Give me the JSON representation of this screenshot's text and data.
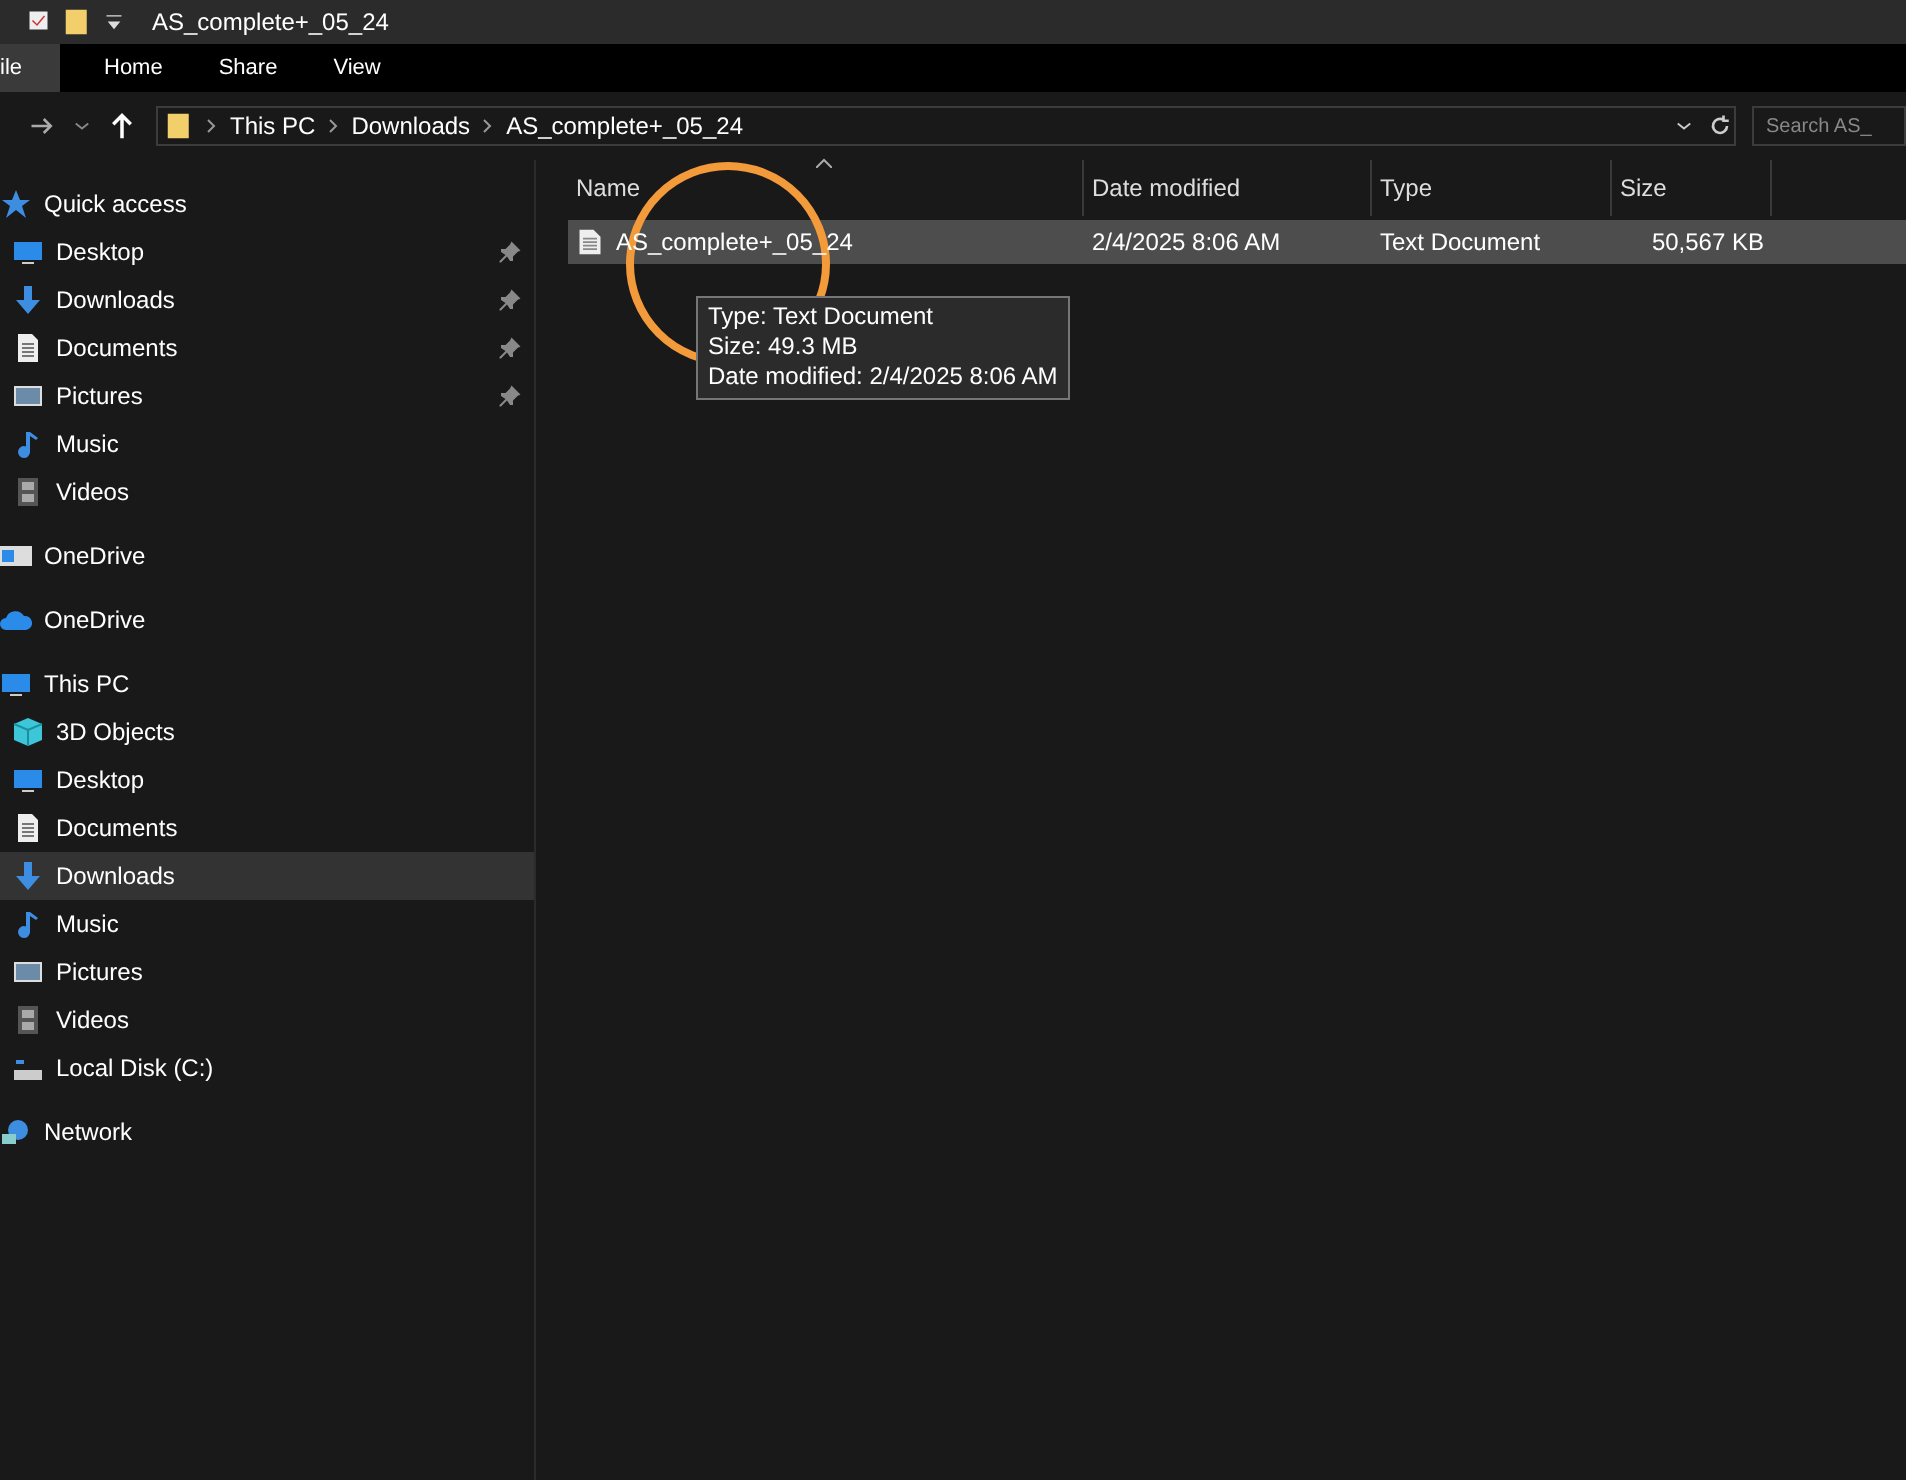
{
  "title_bar": {
    "title": "AS_complete+_05_24"
  },
  "ribbon_tabs": [
    {
      "label": "ile",
      "selected": true
    },
    {
      "label": "Home",
      "selected": false
    },
    {
      "label": "Share",
      "selected": false
    },
    {
      "label": "View",
      "selected": false
    }
  ],
  "address_bar": {
    "path": [
      "This PC",
      "Downloads",
      "AS_complete+_05_24"
    ]
  },
  "search": {
    "placeholder": "Search AS_"
  },
  "sidebar": {
    "items": [
      {
        "label": "Quick access",
        "selected": false,
        "children": [
          {
            "label": "Desktop",
            "pinned": true,
            "selected": false
          },
          {
            "label": "Downloads",
            "pinned": true,
            "selected": false
          },
          {
            "label": "Documents",
            "pinned": true,
            "selected": false
          },
          {
            "label": "Pictures",
            "pinned": true,
            "selected": false
          },
          {
            "label": "Music",
            "pinned": false,
            "selected": false
          },
          {
            "label": "Videos",
            "pinned": false,
            "selected": false
          }
        ]
      },
      {
        "label": "OneDrive",
        "selected": false
      },
      {
        "label": "OneDrive",
        "selected": false
      },
      {
        "label": "This PC",
        "selected": false,
        "children": [
          {
            "label": "3D Objects",
            "pinned": false,
            "selected": false
          },
          {
            "label": "Desktop",
            "pinned": false,
            "selected": false
          },
          {
            "label": "Documents",
            "pinned": false,
            "selected": false
          },
          {
            "label": "Downloads",
            "pinned": false,
            "selected": true
          },
          {
            "label": "Music",
            "pinned": false,
            "selected": false
          },
          {
            "label": "Pictures",
            "pinned": false,
            "selected": false
          },
          {
            "label": "Videos",
            "pinned": false,
            "selected": false
          },
          {
            "label": "Local Disk (C:)",
            "pinned": false,
            "selected": false
          }
        ]
      },
      {
        "label": "Network",
        "selected": false
      }
    ]
  },
  "file_list": {
    "columns": [
      "Name",
      "Date modified",
      "Type",
      "Size"
    ],
    "rows": [
      {
        "cells": [
          "AS_complete+_05_24",
          "2/4/2025 8:06 AM",
          "Text Document",
          "50,567 KB"
        ],
        "selected": true
      }
    ]
  },
  "tooltip": {
    "lines": [
      "Type: Text Document",
      "Size: 49.3 MB",
      "Date modified: 2/4/2025 8:06 AM"
    ]
  }
}
